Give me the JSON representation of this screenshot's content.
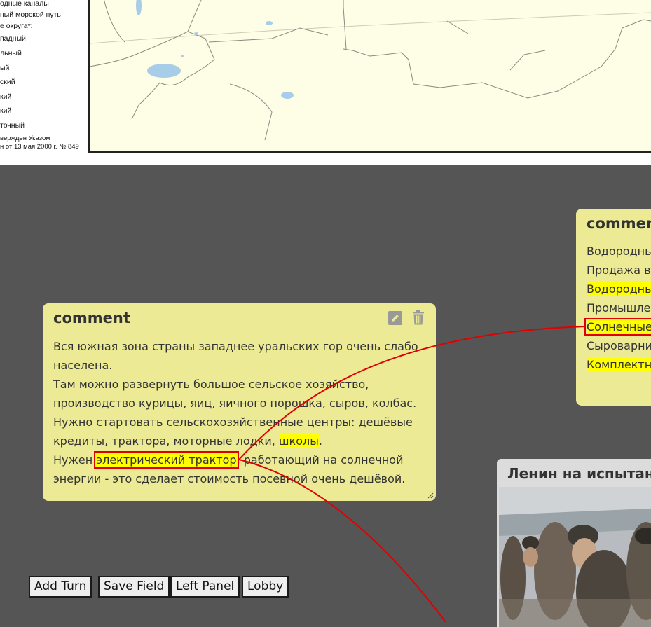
{
  "map": {
    "legend_lines": [
      "одные каналы",
      "ный морской путь",
      "е округа*:",
      "падный",
      "льный",
      "ый",
      "ский",
      "кий",
      "кий",
      "точный",
      "вержден Указом",
      "н от 13 мая 2000 г. № 849"
    ]
  },
  "cards": [
    {
      "title": "comment",
      "lines": [
        [
          {
            "t": "Вся южная зона страны западнее уральских гор очень слабо"
          }
        ],
        [
          {
            "t": "населена."
          }
        ],
        [
          {
            "t": "Там можно развернуть большое сельское хозяйство,"
          }
        ],
        [
          {
            "t": "производство курицы, яиц, яичного порошка, сыров, колбас."
          }
        ],
        [
          {
            "t": "Нужно стартовать сельскохозяйственные центры: дешёвые"
          }
        ],
        [
          {
            "t": "кредиты, трактора, моторные лодки, "
          },
          {
            "t": "школы",
            "hl": true
          },
          {
            "t": "."
          }
        ],
        [
          {
            "t": "Нужен "
          },
          {
            "t": "электрический трактор",
            "box": true
          },
          {
            "t": ", работающий на солнечной"
          }
        ],
        [
          {
            "t": "энергии - это сделает стоимость посевной очень дешёвой."
          }
        ]
      ]
    },
    {
      "title": "commen",
      "lines": [
        [
          {
            "t": "Водородны"
          }
        ],
        [
          {
            "t": "Продажа в"
          }
        ],
        [
          {
            "t": "Водородны",
            "hl": true
          }
        ],
        [
          {
            "t": "Промышле"
          }
        ],
        [
          {
            "t": "Солнечные",
            "box": true
          }
        ],
        [
          {
            "t": "Сыроварни"
          }
        ],
        [
          {
            "t": "Комплектн",
            "hl": true
          }
        ]
      ]
    }
  ],
  "image_card": {
    "title": "Ленин на испытани"
  },
  "buttons": [
    "Add Turn",
    "Save Field",
    "Left Panel",
    "Lobby"
  ],
  "icons": {
    "edit": "pencil-icon",
    "delete": "trash-icon",
    "resize": "resize-grip-icon"
  },
  "colors": {
    "background": "#555555",
    "card": "#ecea95",
    "highlight": "#ffff00",
    "connector": "#e00000",
    "map": "#fefde6"
  }
}
